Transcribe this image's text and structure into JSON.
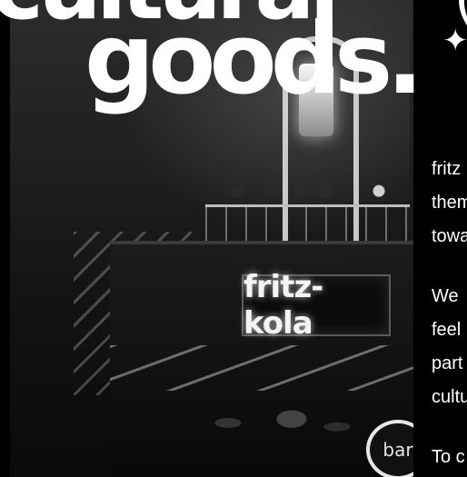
{
  "headline": {
    "line1": "cultural",
    "line2": "goods.",
    "ornament": "(",
    "sparkle": "✦"
  },
  "photo": {
    "sign_text": "fritz-kola",
    "badge_text": "bar"
  },
  "body": {
    "paragraphs": [
      {
        "lines": [
          "fritz",
          "them",
          "towa"
        ]
      },
      {
        "lines": [
          "We",
          "feel",
          "part",
          "cultu"
        ]
      },
      {
        "lines": [
          "To c"
        ]
      }
    ]
  }
}
